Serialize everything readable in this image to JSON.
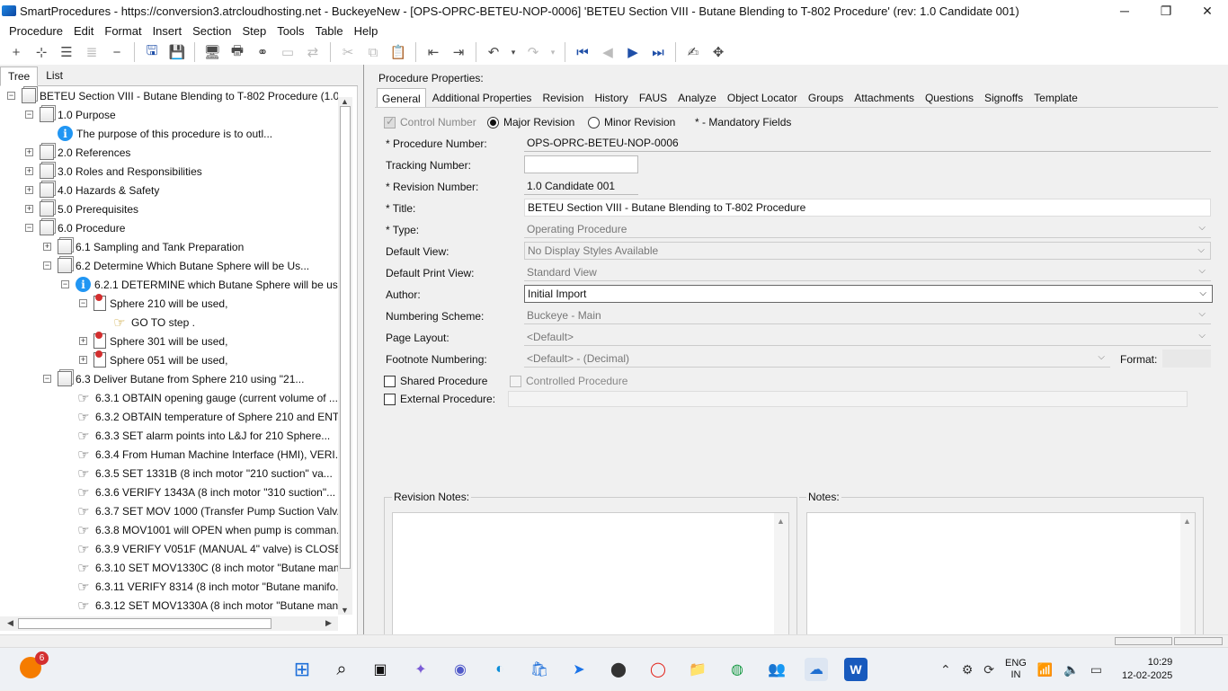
{
  "window": {
    "title": "SmartProcedures - https://conversion3.atrcloudhosting.net - BuckeyeNew - [OPS-OPRC-BETEU-NOP-0006] 'BETEU Section VIII - Butane Blending to T-802 Procedure' (rev: 1.0 Candidate 001)",
    "controls": [
      "─",
      "❐",
      "✕"
    ]
  },
  "menu": [
    "Procedure",
    "Edit",
    "Format",
    "Insert",
    "Section",
    "Step",
    "Tools",
    "Table",
    "Help"
  ],
  "left_tabs": [
    "Tree",
    "List"
  ],
  "tree": [
    {
      "level": 0,
      "expander": "−",
      "icon": "doc",
      "label": "BETEU Section VIII - Butane Blending to T-802 Procedure (1.0..."
    },
    {
      "level": 1,
      "expander": "−",
      "icon": "doc",
      "label": "1.0 Purpose"
    },
    {
      "level": 2,
      "expander": "",
      "icon": "info",
      "label": "The purpose of this procedure is to outl..."
    },
    {
      "level": 1,
      "expander": "+",
      "icon": "doc",
      "label": "2.0 References"
    },
    {
      "level": 1,
      "expander": "+",
      "icon": "doc",
      "label": "3.0 Roles and Responsibilities"
    },
    {
      "level": 1,
      "expander": "+",
      "icon": "doc",
      "label": "4.0 Hazards & Safety"
    },
    {
      "level": 1,
      "expander": "+",
      "icon": "doc",
      "label": "5.0 Prerequisites"
    },
    {
      "level": 1,
      "expander": "−",
      "icon": "doc",
      "label": "6.0 Procedure"
    },
    {
      "level": 2,
      "expander": "+",
      "icon": "doc",
      "label": "6.1 Sampling and Tank Preparation"
    },
    {
      "level": 2,
      "expander": "−",
      "icon": "doc",
      "label": "6.2 Determine Which Butane Sphere will be Us..."
    },
    {
      "level": 3,
      "expander": "−",
      "icon": "info",
      "label": "6.2.1 DETERMINE which Butane Sphere will be us..."
    },
    {
      "level": 4,
      "expander": "−",
      "icon": "bm",
      "label": "Sphere 210 will be used,"
    },
    {
      "level": 5,
      "expander": "",
      "icon": "goto",
      "label": "GO TO step ."
    },
    {
      "level": 4,
      "expander": "+",
      "icon": "bm",
      "label": "Sphere 301 will be used,"
    },
    {
      "level": 4,
      "expander": "+",
      "icon": "bm",
      "label": "Sphere 051 will be used,"
    },
    {
      "level": 2,
      "expander": "−",
      "icon": "doc",
      "label": "6.3 Deliver Butane from Sphere 210 using \"21..."
    },
    {
      "level": 3,
      "expander": "",
      "icon": "step",
      "label": "6.3.1 OBTAIN opening gauge (current volume of ..."
    },
    {
      "level": 3,
      "expander": "",
      "icon": "step",
      "label": "6.3.2 OBTAIN temperature of Sphere 210 and ENT..."
    },
    {
      "level": 3,
      "expander": "",
      "icon": "step",
      "label": "6.3.3 SET alarm points into L&J for 210 Sphere..."
    },
    {
      "level": 3,
      "expander": "",
      "icon": "step",
      "label": "6.3.4 From Human Machine Interface (HMI), VERI..."
    },
    {
      "level": 3,
      "expander": "",
      "icon": "step",
      "label": "6.3.5 SET 1331B (8 inch motor \"210 suction\" va..."
    },
    {
      "level": 3,
      "expander": "",
      "icon": "step",
      "label": "6.3.6 VERIFY 1343A (8 inch motor \"310 suction\"..."
    },
    {
      "level": 3,
      "expander": "",
      "icon": "step",
      "label": "6.3.7 SET MOV 1000 (Transfer Pump Suction Valv..."
    },
    {
      "level": 3,
      "expander": "",
      "icon": "step",
      "label": "6.3.8 MOV1001 will OPEN when pump is comman..."
    },
    {
      "level": 3,
      "expander": "",
      "icon": "step",
      "label": "6.3.9 VERIFY V051F (MANUAL 4\" valve) is CLOSE..."
    },
    {
      "level": 3,
      "expander": "",
      "icon": "step",
      "label": "6.3.10 SET MOV1330C (8 inch motor \"Butane man..."
    },
    {
      "level": 3,
      "expander": "",
      "icon": "step",
      "label": "6.3.11 VERIFY 8314 (8 inch motor \"Butane manifo..."
    },
    {
      "level": 3,
      "expander": "",
      "icon": "step",
      "label": "6.3.12 SET MOV1330A (8 inch motor \"Butane man..."
    }
  ],
  "props": {
    "title": "Procedure Properties:",
    "tabs": [
      "General",
      "Additional Properties",
      "Revision",
      "History",
      "FAUS",
      "Analyze",
      "Object Locator",
      "Groups",
      "Attachments",
      "Questions",
      "Signoffs",
      "Template"
    ],
    "control_number": "Control Number",
    "major_revision": "Major Revision",
    "minor_revision": "Minor Revision",
    "mandatory": "* - Mandatory Fields",
    "fields": {
      "procedure_number": {
        "label": "* Procedure Number:",
        "value": "OPS-OPRC-BETEU-NOP-0006"
      },
      "tracking_number": {
        "label": "Tracking Number:",
        "value": ""
      },
      "revision_number": {
        "label": "* Revision Number:",
        "value": "1.0 Candidate 001"
      },
      "title": {
        "label": "* Title:",
        "value": "BETEU Section VIII - Butane Blending to T-802 Procedure"
      },
      "type": {
        "label": "* Type:",
        "value": "Operating Procedure"
      },
      "default_view": {
        "label": "Default View:",
        "value": "No Display Styles Available"
      },
      "default_print_view": {
        "label": "Default Print View:",
        "value": "Standard View"
      },
      "author": {
        "label": "Author:",
        "value": "Initial Import"
      },
      "numbering_scheme": {
        "label": "Numbering Scheme:",
        "value": "Buckeye - Main"
      },
      "page_layout": {
        "label": "Page Layout:",
        "value": "<Default>"
      },
      "footnote_numbering": {
        "label": "Footnote Numbering:",
        "value": "<Default> - (Decimal)"
      },
      "format": {
        "label": "Format:",
        "value": ""
      }
    },
    "shared_procedure": "Shared Procedure",
    "controlled_procedure": "Controlled Procedure",
    "external_procedure": "External Procedure:",
    "revision_notes": "Revision Notes:",
    "notes": "Notes:"
  },
  "taskbar": {
    "notification_count": "6",
    "lang": [
      "ENG",
      "IN"
    ],
    "time": "10:29",
    "date": "12-02-2025"
  }
}
